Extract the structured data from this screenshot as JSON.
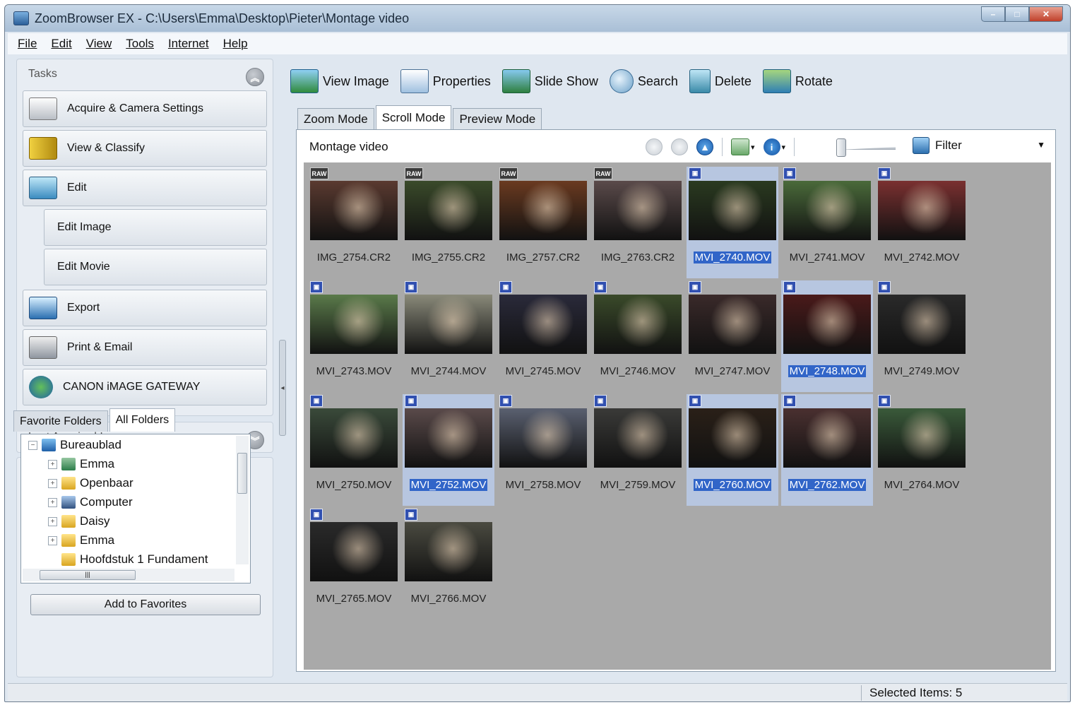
{
  "window": {
    "title": "ZoomBrowser EX  -  C:\\Users\\Emma\\Desktop\\Pieter\\Montage video"
  },
  "menu": [
    "File",
    "Edit",
    "View",
    "Tools",
    "Internet",
    "Help"
  ],
  "tasks": {
    "title": "Tasks",
    "buttons": [
      "Acquire & Camera Settings",
      "View & Classify",
      "Edit",
      "Edit Image",
      "Edit Movie",
      "Export",
      "Print & Email",
      "CANON iMAGE GATEWAY"
    ]
  },
  "last_acquired": {
    "title": "Last Acquired Images"
  },
  "folders": {
    "tabs": [
      "Favorite Folders",
      "All Folders"
    ],
    "active_tab": "All Folders",
    "tree": [
      "Bureaublad",
      "Emma",
      "Openbaar",
      "Computer",
      "Daisy",
      "Emma",
      "Hoofdstuk 1 Fundament"
    ],
    "add_button": "Add to Favorites"
  },
  "toolbar": [
    "View Image",
    "Properties",
    "Slide Show",
    "Search",
    "Delete",
    "Rotate"
  ],
  "modes": [
    "Zoom Mode",
    "Scroll Mode",
    "Preview Mode"
  ],
  "active_mode": "Scroll Mode",
  "breadcrumb": "Montage video",
  "filter_label": "Filter",
  "thumbnails": [
    {
      "name": "IMG_2754.CR2",
      "type": "RAW",
      "selected": false,
      "color": "#5a3a30"
    },
    {
      "name": "IMG_2755.CR2",
      "type": "RAW",
      "selected": false,
      "color": "#3a4a2a"
    },
    {
      "name": "IMG_2757.CR2",
      "type": "RAW",
      "selected": false,
      "color": "#6a3a20"
    },
    {
      "name": "IMG_2763.CR2",
      "type": "RAW",
      "selected": false,
      "color": "#5a4a4a"
    },
    {
      "name": "MVI_2740.MOV",
      "type": "MOV",
      "selected": true,
      "color": "#2a3a20"
    },
    {
      "name": "MVI_2741.MOV",
      "type": "MOV",
      "selected": false,
      "color": "#4a6a3a"
    },
    {
      "name": "MVI_2742.MOV",
      "type": "MOV",
      "selected": false,
      "color": "#7a3030"
    },
    {
      "name": "MVI_2743.MOV",
      "type": "MOV",
      "selected": false,
      "color": "#5a7a4a"
    },
    {
      "name": "MVI_2744.MOV",
      "type": "MOV",
      "selected": false,
      "color": "#8a8a7a"
    },
    {
      "name": "MVI_2745.MOV",
      "type": "MOV",
      "selected": false,
      "color": "#2a2a3a"
    },
    {
      "name": "MVI_2746.MOV",
      "type": "MOV",
      "selected": false,
      "color": "#3a4a2a"
    },
    {
      "name": "MVI_2747.MOV",
      "type": "MOV",
      "selected": false,
      "color": "#3a2a2a"
    },
    {
      "name": "MVI_2748.MOV",
      "type": "MOV",
      "selected": true,
      "color": "#4a1a1a"
    },
    {
      "name": "MVI_2749.MOV",
      "type": "MOV",
      "selected": false,
      "color": "#2a2a2a"
    },
    {
      "name": "MVI_2750.MOV",
      "type": "MOV",
      "selected": false,
      "color": "#3a4a3a"
    },
    {
      "name": "MVI_2752.MOV",
      "type": "MOV",
      "selected": true,
      "color": "#5a4a4a"
    },
    {
      "name": "MVI_2758.MOV",
      "type": "MOV",
      "selected": false,
      "color": "#5a6070"
    },
    {
      "name": "MVI_2759.MOV",
      "type": "MOV",
      "selected": false,
      "color": "#3a3a38"
    },
    {
      "name": "MVI_2760.MOV",
      "type": "MOV",
      "selected": true,
      "color": "#2a2018"
    },
    {
      "name": "MVI_2762.MOV",
      "type": "MOV",
      "selected": true,
      "color": "#4a3030"
    },
    {
      "name": "MVI_2764.MOV",
      "type": "MOV",
      "selected": false,
      "color": "#3a5a3a"
    },
    {
      "name": "MVI_2765.MOV",
      "type": "MOV",
      "selected": false,
      "color": "#2a2a2a"
    },
    {
      "name": "MVI_2766.MOV",
      "type": "MOV",
      "selected": false,
      "color": "#4a4a40"
    }
  ],
  "status": "Selected Items: 5",
  "colors": {
    "selection": "#3165c8",
    "grid_bg": "#a9a9a9",
    "panel_bg": "#e8edf3"
  }
}
